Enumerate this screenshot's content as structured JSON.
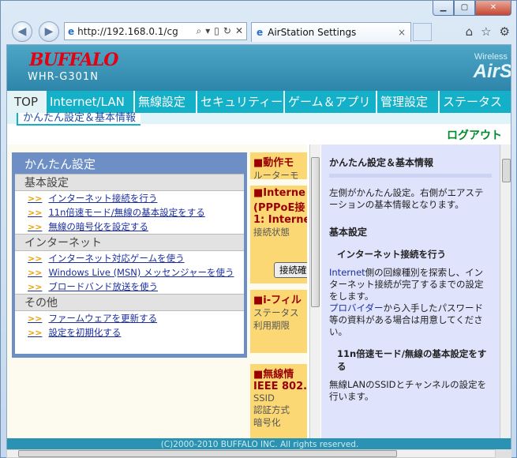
{
  "browser": {
    "address": "http://192.168.0.1/cg",
    "tab_title": "AirStation Settings",
    "tab_close": "×"
  },
  "header": {
    "logo": "BUFFALO",
    "model": "WHR-G301N",
    "wireless": "Wireless",
    "brand": "AirS"
  },
  "menu": {
    "items": [
      "TOP",
      "Internet/LAN",
      "無線設定",
      "セキュリティー",
      "ゲーム＆アプリ",
      "管理設定",
      "ステータス"
    ]
  },
  "submenu": "かんたん設定＆基本情報",
  "logout": "ログアウト",
  "easy": {
    "title": "かんたん設定",
    "sections": [
      {
        "name": "基本設定",
        "links": [
          "インターネット接続を行う",
          "11n倍速モード/無線の基本設定をする",
          "無線の暗号化を設定する"
        ]
      },
      {
        "name": "インターネット",
        "links": [
          "インターネット対応ゲームを使う",
          "Windows Live (MSN) メッセンジャーを使う",
          "ブロードバンド放送を使う"
        ]
      },
      {
        "name": "その他",
        "links": [
          "ファームウェアを更新する",
          "設定を初期化する"
        ]
      }
    ]
  },
  "status_blocks": {
    "mode_title": "■動作モ",
    "mode_sub": "ルーターモ",
    "net_title1": "■Interne",
    "net_title2": "(PPPoE接",
    "net_title3": "1: Interne",
    "net_sub": "接続状態",
    "net_btn": "接続確",
    "ifil_title": "■i-フィル",
    "ifil_sub1": "ステータス",
    "ifil_sub2": "利用期限",
    "wl_title": "■無線情",
    "wl_title2": "IEEE 802.",
    "wl_sub1": "SSID",
    "wl_sub2": "認証方式",
    "wl_sub3": "暗号化"
  },
  "info": {
    "title": "かんたん設定＆基本情報",
    "intro": "左側がかんたん設定。右側がエアステーションの基本情報となります。",
    "basic": "基本設定",
    "h1": "インターネット接続を行う",
    "p1_link": "Internet",
    "p1": "側の回線種別を探索し、インターネット接続が完了するまでの設定をします。",
    "p1b_link": "プロバイダー",
    "p1b": "から入手したパスワード等の資料がある場合は用意してください。",
    "h2": "11n倍速モード/無線の基本設定をする",
    "p2": "無線LANのSSIDとチャンネルの設定を行います。"
  },
  "footer": "(C)2000-2010 BUFFALO INC. All rights reserved."
}
